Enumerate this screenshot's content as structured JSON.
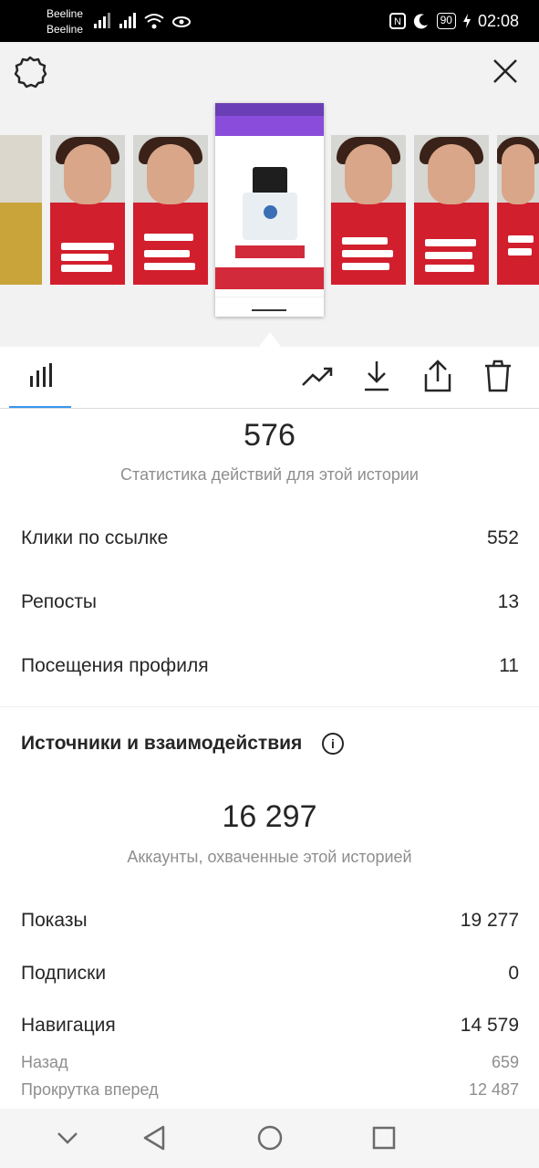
{
  "status_bar": {
    "carrier1": "Beeline",
    "carrier2": "Beeline",
    "battery": "90",
    "time": "02:08"
  },
  "story_preview": {
    "thumbnails": [
      "story-1",
      "story-2",
      "story-3",
      "story-4",
      "story-5",
      "story-6",
      "story-7"
    ],
    "selected_index": 3
  },
  "tabs": {
    "icons": [
      "bar-chart-icon",
      "trending-up-icon",
      "download-icon",
      "share-icon",
      "trash-icon"
    ]
  },
  "actions": {
    "total": "576",
    "subtitle": "Статистика действий для этой истории",
    "rows": [
      {
        "label": "Клики по ссылке",
        "value": "552"
      },
      {
        "label": "Репосты",
        "value": "13"
      },
      {
        "label": "Посещения профиля",
        "value": "11"
      }
    ]
  },
  "discovery": {
    "heading": "Источники и взаимодействия",
    "info_glyph": "i",
    "reach": "16 297",
    "reach_subtitle": "Аккаунты, охваченные этой историей",
    "rows": [
      {
        "label": "Показы",
        "value": "19 277"
      },
      {
        "label": "Подписки",
        "value": "0"
      },
      {
        "label": "Навигация",
        "value": "14 579"
      }
    ],
    "sub_rows": [
      {
        "label": "Назад",
        "value": "659"
      },
      {
        "label": "Прокрутка вперед",
        "value": "12 487"
      }
    ]
  }
}
